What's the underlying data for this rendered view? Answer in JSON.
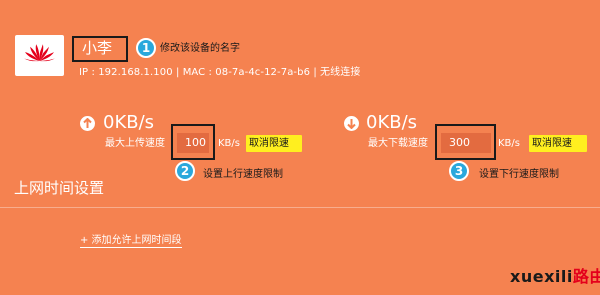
{
  "device": {
    "logo": "huawei-logo",
    "name": "小李",
    "info": "IP : 192.168.1.100 | MAC : 08-7a-4c-12-7a-b6 | 无线连接"
  },
  "upload": {
    "icon": "arrow-up-circle-icon",
    "speed": "0KB/s",
    "label": "最大上传速度",
    "limit_value": "100",
    "unit": "KB/s",
    "cancel_label": "取消限速"
  },
  "download": {
    "icon": "arrow-down-circle-icon",
    "speed": "0KB/s",
    "label": "最大下载速度",
    "limit_value": "300",
    "unit": "KB/s",
    "cancel_label": "取消限速"
  },
  "callouts": [
    {
      "number": "1",
      "text": "修改该设备的名字"
    },
    {
      "number": "2",
      "text": "设置上行速度限制"
    },
    {
      "number": "3",
      "text": "设置下行速度限制"
    }
  ],
  "section": {
    "title": "上网时间设置",
    "add_link": "+ 添加允许上网时间段"
  },
  "watermark": {
    "site": "xuexili",
    "logo_text": "路由网"
  },
  "colors": {
    "background": "#f58250",
    "callout": "#2aa8dc",
    "cancel_button": "#ffef1f",
    "input_bg": "#e36b40",
    "huawei_red": "#e4001b"
  }
}
